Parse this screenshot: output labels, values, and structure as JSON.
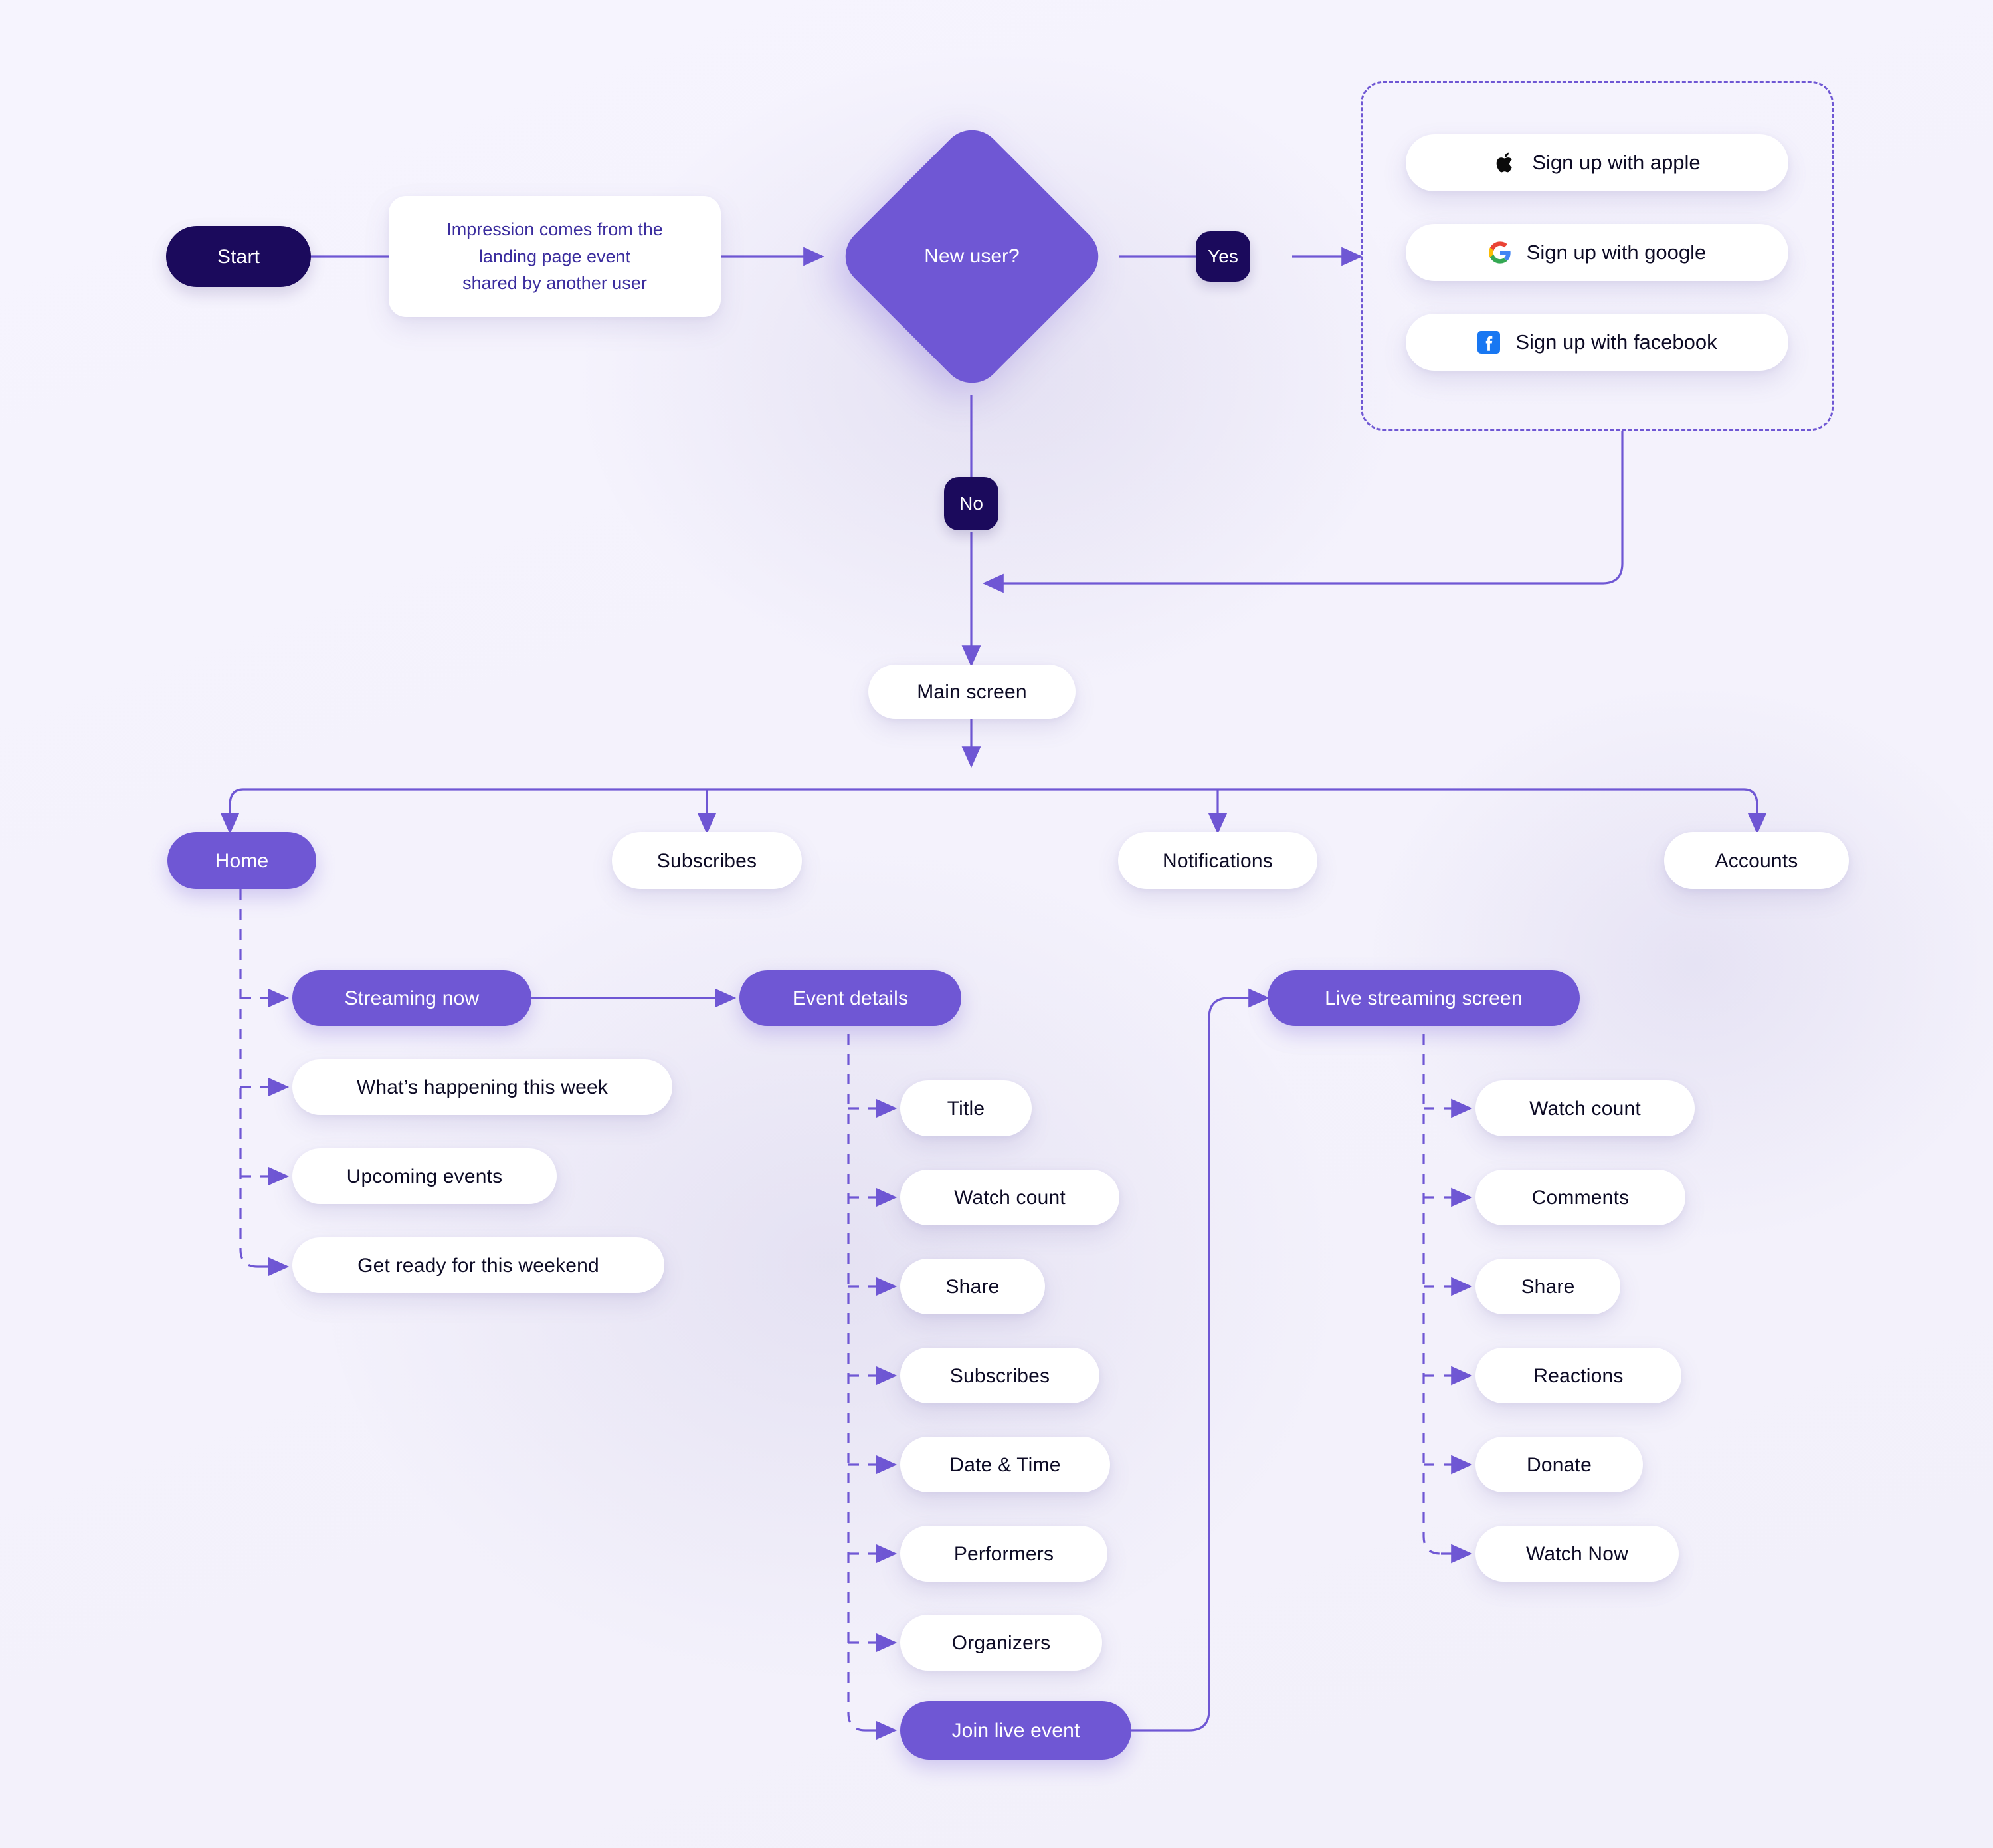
{
  "flow": {
    "start": {
      "label": "Start"
    },
    "impression_note": {
      "line1": "Impression comes from the",
      "line2": "landing page event",
      "line3": "shared by another user"
    },
    "decision": {
      "label": "New user?"
    },
    "branch_yes": {
      "label": "Yes"
    },
    "branch_no": {
      "label": "No"
    },
    "main_screen": {
      "label": "Main screen"
    }
  },
  "signup": {
    "options": [
      {
        "label": "Sign up with apple",
        "icon": "apple-icon"
      },
      {
        "label": "Sign up with google",
        "icon": "google-icon"
      },
      {
        "label": "Sign up with facebook",
        "icon": "facebook-icon"
      }
    ]
  },
  "nav": {
    "items": [
      {
        "label": "Home",
        "active": true
      },
      {
        "label": "Subscribes",
        "active": false
      },
      {
        "label": "Notifications",
        "active": false
      },
      {
        "label": "Accounts",
        "active": false
      }
    ]
  },
  "home_children": [
    {
      "label": "Streaming now",
      "highlight": true
    },
    {
      "label": "What’s happening this week",
      "highlight": false
    },
    {
      "label": "Upcoming events",
      "highlight": false
    },
    {
      "label": "Get ready for this weekend",
      "highlight": false
    }
  ],
  "event_details": {
    "label": "Event details",
    "children": [
      {
        "label": "Title",
        "highlight": false
      },
      {
        "label": "Watch count",
        "highlight": false
      },
      {
        "label": "Share",
        "highlight": false
      },
      {
        "label": "Subscribes",
        "highlight": false
      },
      {
        "label": "Date & Time",
        "highlight": false
      },
      {
        "label": "Performers",
        "highlight": false
      },
      {
        "label": "Organizers",
        "highlight": false
      },
      {
        "label": "Join live event",
        "highlight": true
      }
    ]
  },
  "live_streaming": {
    "label": "Live streaming screen",
    "children": [
      {
        "label": "Watch count",
        "highlight": false
      },
      {
        "label": "Comments",
        "highlight": false
      },
      {
        "label": "Share",
        "highlight": false
      },
      {
        "label": "Reactions",
        "highlight": false
      },
      {
        "label": "Donate",
        "highlight": false
      },
      {
        "label": "Watch Now",
        "highlight": false
      }
    ]
  },
  "colors": {
    "accent_purple": "#6f57d4",
    "dark_navy": "#1b0a5c",
    "node_white": "#ffffff",
    "background": "#f4f2fc",
    "connector": "#6f57d4",
    "note_text": "#3b2d9e"
  }
}
